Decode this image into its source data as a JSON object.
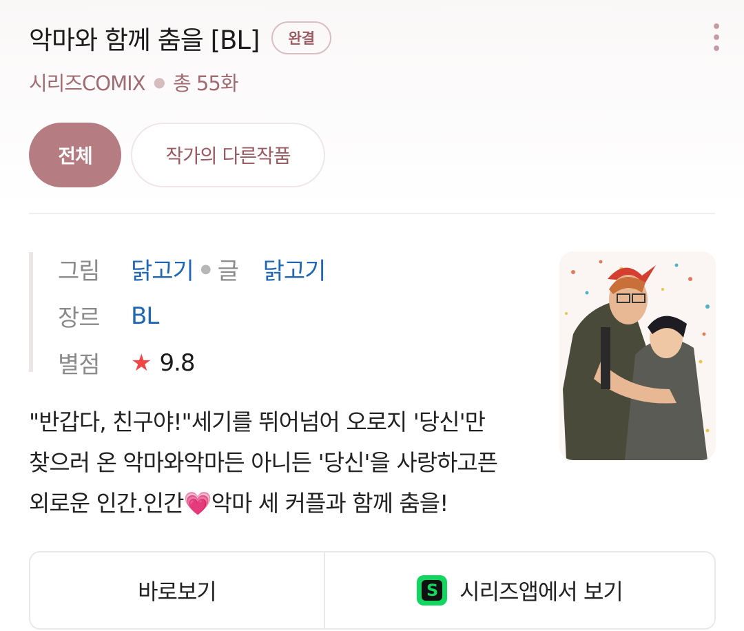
{
  "header": {
    "title": "악마와 함께 춤을 [BL]",
    "status_badge": "완결",
    "publisher": "시리즈COMIX",
    "episode_count": "총 55화"
  },
  "tabs": [
    {
      "label": "전체",
      "active": true
    },
    {
      "label": "작가의 다른작품",
      "active": false
    }
  ],
  "info": {
    "illustration_label": "그림",
    "illustration_value": "닭고기",
    "writer_label": "글",
    "writer_value": "닭고기",
    "genre_label": "장르",
    "genre_value": "BL",
    "rating_label": "별점",
    "rating_value": "9.8",
    "star_icon": "star-icon"
  },
  "description": {
    "line1": "\"반갑다, 친구야!\"세기를 뛰어넘어 오로지 '당신'만",
    "line2": "찾으러 온 악마와악마든 아니든 '당신'을 사랑하고픈",
    "line3": "외로운 인간.인간💗악마 세 커플과 함께 춤을!"
  },
  "actions": {
    "view_now": "바로보기",
    "series_app": "시리즈앱에서 보기",
    "series_app_icon": "series-app-icon"
  },
  "colors": {
    "accent": "#b57c82",
    "link": "#1f67b4",
    "star": "#f04646",
    "series_green": "#12d65f"
  }
}
